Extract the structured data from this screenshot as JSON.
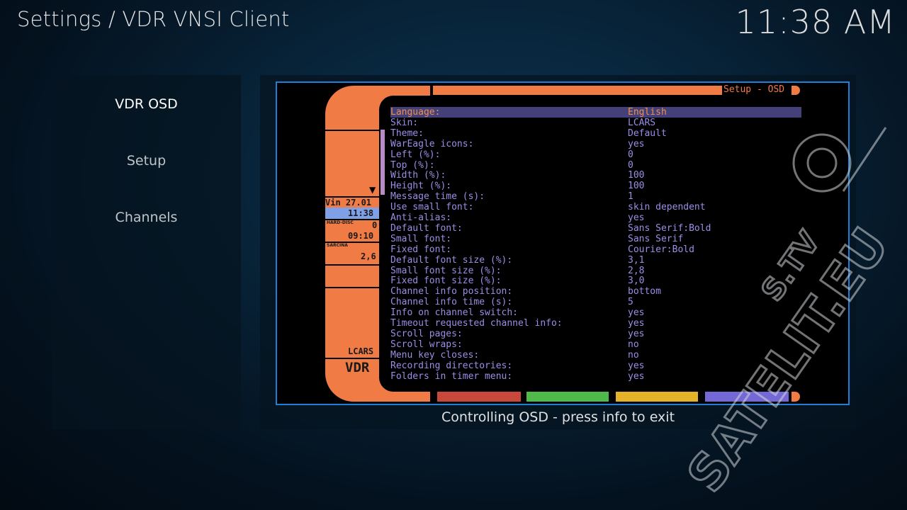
{
  "header": {
    "title": "Settings / VDR VNSI Client",
    "clock": "11:38 AM"
  },
  "sidebar": {
    "items": [
      {
        "label": "VDR OSD",
        "active": true
      },
      {
        "label": "Setup",
        "active": false
      },
      {
        "label": "Channels",
        "active": false
      }
    ]
  },
  "osd": {
    "title": "Setup - OSD",
    "left_panel": {
      "date": "Vin 27.01",
      "time": "11:38",
      "disk_label": "HARD-DISC",
      "disk_value": "0",
      "disk_time": "09:10",
      "load_label": "SARCINA",
      "load_value": "2,6",
      "skin": "LCARS",
      "brand": "VDR",
      "arrow": "▼"
    },
    "settings": [
      {
        "label": "Language:",
        "value": "English",
        "selected": true
      },
      {
        "label": "Skin:",
        "value": "LCARS"
      },
      {
        "label": "Theme:",
        "value": "Default"
      },
      {
        "label": "WarEagle icons:",
        "value": "yes"
      },
      {
        "label": "Left (%):",
        "value": "0"
      },
      {
        "label": "Top (%):",
        "value": "0"
      },
      {
        "label": "Width (%):",
        "value": "100"
      },
      {
        "label": "Height (%):",
        "value": "100"
      },
      {
        "label": "Message time (s):",
        "value": "1"
      },
      {
        "label": "Use small font:",
        "value": "skin dependent"
      },
      {
        "label": "Anti-alias:",
        "value": "yes"
      },
      {
        "label": "Default font:",
        "value": "Sans Serif:Bold"
      },
      {
        "label": "Small font:",
        "value": "Sans Serif"
      },
      {
        "label": "Fixed font:",
        "value": "Courier:Bold"
      },
      {
        "label": "Default font size (%):",
        "value": "3,1"
      },
      {
        "label": "Small font size (%):",
        "value": "2,8"
      },
      {
        "label": "Fixed font size (%):",
        "value": "3,0"
      },
      {
        "label": "Channel info position:",
        "value": "bottom"
      },
      {
        "label": "Channel info time (s):",
        "value": "5"
      },
      {
        "label": "Info on channel switch:",
        "value": "yes"
      },
      {
        "label": "Timeout requested channel info:",
        "value": "yes"
      },
      {
        "label": "Scroll pages:",
        "value": "yes"
      },
      {
        "label": "Scroll wraps:",
        "value": "no"
      },
      {
        "label": "Menu key closes:",
        "value": "no"
      },
      {
        "label": "Recording directories:",
        "value": "yes"
      },
      {
        "label": "Folders in timer menu:",
        "value": "yes"
      }
    ],
    "colors": {
      "orange": "#f07b45",
      "red": "#c9483c",
      "green": "#4fba4a",
      "yellow": "#e6b22a",
      "blue": "#7468d6",
      "menu_text": "#9a8fe6",
      "selected_bg": "#44407a"
    }
  },
  "caption": "Controlling OSD - press info to exit",
  "watermark": {
    "text": "SATELIT.EU",
    "text2": "S.TV"
  },
  "theme": {
    "frame_border": "#1f7fd6"
  }
}
